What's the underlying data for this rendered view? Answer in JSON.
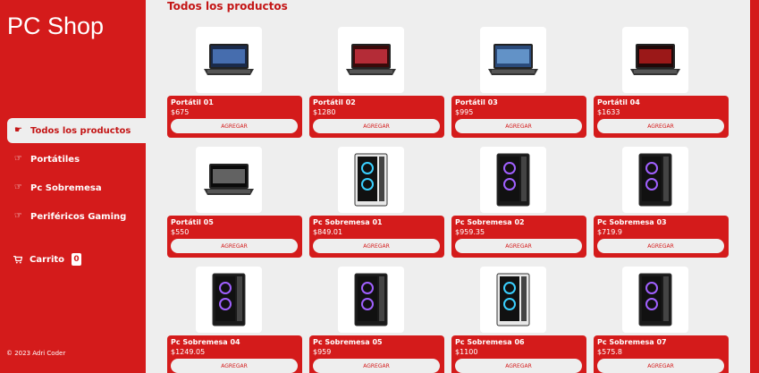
{
  "brand": "PC Shop",
  "nav": {
    "items": [
      {
        "label": "Todos los productos",
        "active": true
      },
      {
        "label": "Portátiles",
        "active": false
      },
      {
        "label": "Pc Sobremesa",
        "active": false
      },
      {
        "label": "Periféricos Gaming",
        "active": false
      }
    ]
  },
  "cart": {
    "label": "Carrito",
    "count": "0",
    "icon": "cart-icon"
  },
  "footer": "© 2023 Adri Coder",
  "page_title": "Todos los productos",
  "add_label": "AGREGAR",
  "products": [
    {
      "name": "Portátil 01",
      "price": "$675",
      "kind": "laptop-silver"
    },
    {
      "name": "Portátil 02",
      "price": "$1280",
      "kind": "laptop-red"
    },
    {
      "name": "Portátil 03",
      "price": "$995",
      "kind": "laptop-gray"
    },
    {
      "name": "Portátil 04",
      "price": "$1633",
      "kind": "laptop-acer"
    },
    {
      "name": "Portátil 05",
      "price": "$550",
      "kind": "laptop-nitro"
    },
    {
      "name": "Pc Sobremesa 01",
      "price": "$849.01",
      "kind": "tower-white"
    },
    {
      "name": "Pc Sobremesa 02",
      "price": "$959.35",
      "kind": "tower-black"
    },
    {
      "name": "Pc Sobremesa 03",
      "price": "$719.9",
      "kind": "tower-black"
    },
    {
      "name": "Pc Sobremesa 04",
      "price": "$1249.05",
      "kind": "tower-black"
    },
    {
      "name": "Pc Sobremesa 05",
      "price": "$959",
      "kind": "tower-black"
    },
    {
      "name": "Pc Sobremesa 06",
      "price": "$1100",
      "kind": "tower-white"
    },
    {
      "name": "Pc Sobremesa 07",
      "price": "$575.8",
      "kind": "tower-black"
    }
  ],
  "colors": {
    "accent": "#d41b1b",
    "background": "#eeeeee",
    "card": "#ffffff"
  }
}
